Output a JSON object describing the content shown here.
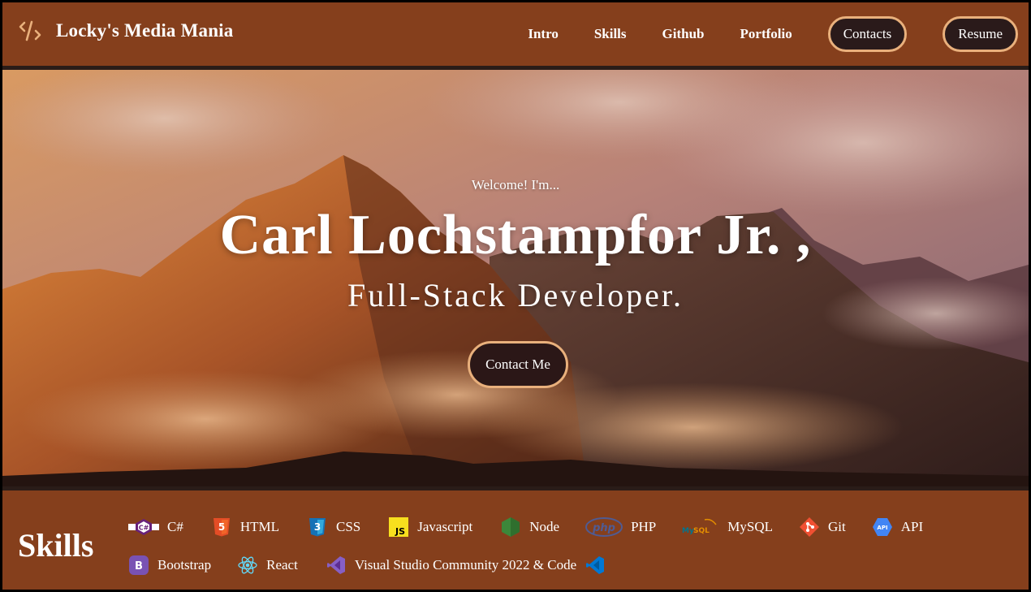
{
  "brand": {
    "title": "Locky's Media Mania",
    "icon": "code-slash-icon",
    "accent": "#e9b07c"
  },
  "nav": {
    "links": [
      "Intro",
      "Skills",
      "Github",
      "Portfolio"
    ],
    "contacts_label": "Contacts",
    "resume_label": "Resume"
  },
  "hero": {
    "welcome": "Welcome! I'm...",
    "name": "Carl Lochstampfor Jr. ,",
    "role": "Full-Stack Developer.",
    "cta_label": "Contact Me"
  },
  "skills": {
    "title": "Skills",
    "row1": [
      {
        "label": "C#",
        "icon": "csharp-icon"
      },
      {
        "label": "HTML",
        "icon": "html5-icon"
      },
      {
        "label": "CSS",
        "icon": "css3-icon"
      },
      {
        "label": "Javascript",
        "icon": "javascript-icon"
      },
      {
        "label": "Node",
        "icon": "nodejs-icon"
      },
      {
        "label": "PHP",
        "icon": "php-icon"
      },
      {
        "label": "MySQL",
        "icon": "mysql-icon"
      },
      {
        "label": "Git",
        "icon": "git-icon"
      },
      {
        "label": "API",
        "icon": "api-icon"
      }
    ],
    "row2": [
      {
        "label": "Bootstrap",
        "icon": "bootstrap-icon"
      },
      {
        "label": "React",
        "icon": "react-icon"
      },
      {
        "label": "Visual Studio Community 2022 & Code",
        "icon": "visual-studio-icon"
      }
    ],
    "trailing_icon": "vscode-icon"
  },
  "colors": {
    "nav_bg": "#853f1c",
    "divider": "#2a1c18",
    "pill_bg": "#2a1a1a",
    "pill_border": "#e9b07c"
  }
}
